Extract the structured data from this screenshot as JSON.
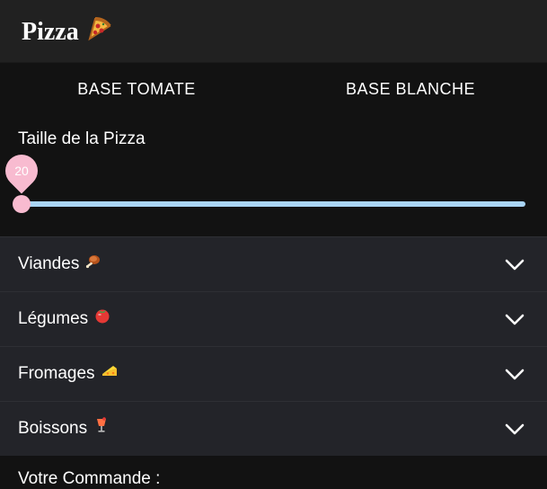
{
  "header": {
    "title": "Pizza",
    "icon": "pizza-icon"
  },
  "tabs": [
    {
      "label": "BASE TOMATE"
    },
    {
      "label": "BASE BLANCHE"
    }
  ],
  "size": {
    "label": "Taille de la Pizza",
    "value": "20",
    "level": 0,
    "colors": {
      "track": "#a9d4f5",
      "thumb": "#f8bbd0"
    }
  },
  "accordions": [
    {
      "label": "Viandes",
      "icon": "meat-icon"
    },
    {
      "label": "Légumes",
      "icon": "tomato-icon"
    },
    {
      "label": "Fromages",
      "icon": "cheese-icon"
    },
    {
      "label": "Boissons",
      "icon": "drink-icon"
    }
  ],
  "order": {
    "title": "Votre Commande :"
  }
}
